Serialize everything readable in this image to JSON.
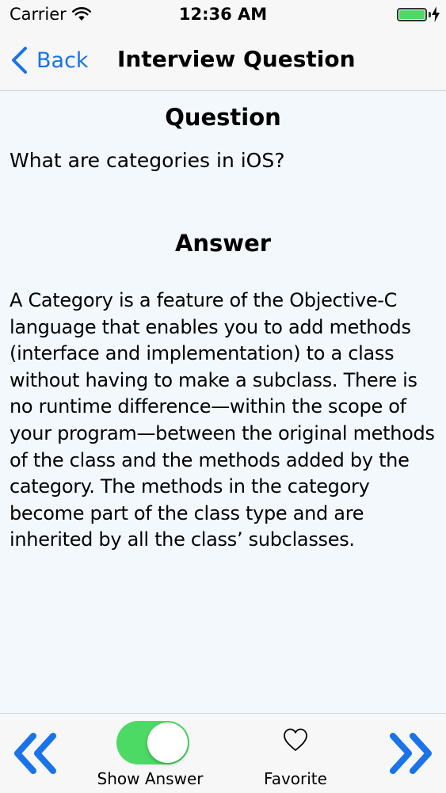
{
  "status_bar": {
    "carrier": "Carrier",
    "time": "12:36 AM"
  },
  "nav": {
    "back_label": "Back",
    "title": "Interview Question"
  },
  "question": {
    "heading": "Question",
    "text": "What are categories in iOS?"
  },
  "answer": {
    "heading": "Answer",
    "text": "A Category is a feature of the Objective-C language that enables you to add methods (interface and implementation) to a class without having to make a subclass. There is no runtime difference—within the scope of your program—between the original methods of the class and the methods added by the category. The methods in the category become part of the class type and are inherited by all the class’ subclasses."
  },
  "toolbar": {
    "prev_icon": "double-chevron-left-icon",
    "show_answer_label": "Show Answer",
    "show_answer_on": true,
    "favorite_icon": "heart-outline-icon",
    "favorite_label": "Favorite",
    "next_icon": "double-chevron-right-icon"
  },
  "colors": {
    "accent": "#1a73e8",
    "toggle_on": "#4cd964",
    "battery": "#4cd964",
    "content_background": "#f2f8fc"
  }
}
